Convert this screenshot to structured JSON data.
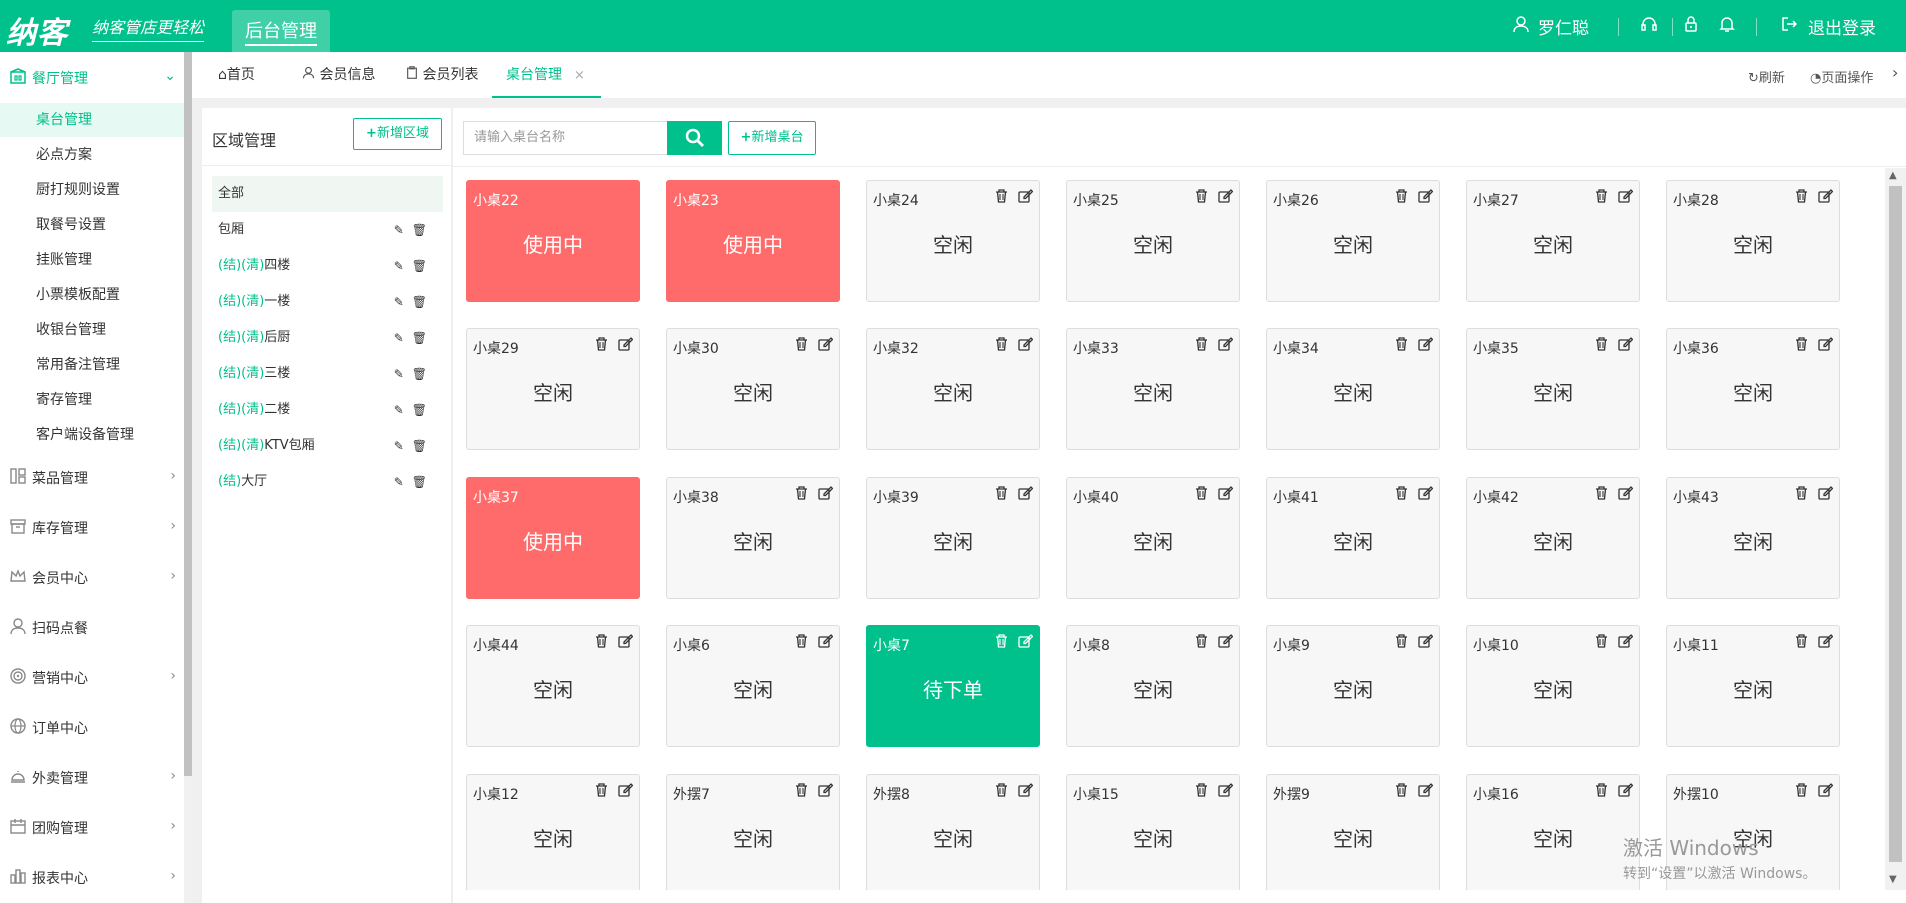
{
  "header": {
    "logo": "纳客",
    "slogan": "纳客管店更轻松",
    "app_tab": "后台管理",
    "user_name": "罗仁聪",
    "logout_label": "退出登录"
  },
  "sidebar": {
    "groups": [
      {
        "label": "餐厅管理",
        "icon": "restaurant-icon",
        "expanded": true,
        "items": [
          "桌台管理",
          "必点方案",
          "厨打规则设置",
          "取餐号设置",
          "挂账管理",
          "小票模板配置",
          "收银台管理",
          "常用备注管理",
          "寄存管理",
          "客户端设备管理"
        ],
        "active_item": "桌台管理"
      },
      {
        "label": "菜品管理",
        "icon": "dishes-icon"
      },
      {
        "label": "库存管理",
        "icon": "inventory-icon"
      },
      {
        "label": "会员中心",
        "icon": "crown-icon"
      },
      {
        "label": "扫码点餐",
        "icon": "user-icon"
      },
      {
        "label": "营销中心",
        "icon": "target-icon"
      },
      {
        "label": "订单中心",
        "icon": "globe-icon"
      },
      {
        "label": "外卖管理",
        "icon": "cloche-icon"
      },
      {
        "label": "团购管理",
        "icon": "calendar-icon"
      },
      {
        "label": "报表中心",
        "icon": "bar-chart-icon"
      }
    ]
  },
  "tabs": [
    {
      "label": "首页",
      "icon": "home-icon"
    },
    {
      "label": "会员信息",
      "icon": "user-icon"
    },
    {
      "label": "会员列表",
      "icon": "clipboard-icon"
    },
    {
      "label": "桌台管理",
      "active": true,
      "close": "×"
    }
  ],
  "tab_actions": {
    "refresh": "刷新",
    "page_ops": "页面操作"
  },
  "area_panel": {
    "title": "区域管理",
    "add_button": "新增区域",
    "all_label": "全部",
    "areas": [
      {
        "prefix": "",
        "name": "包厢"
      },
      {
        "prefix": "(结)(清)",
        "name": "四楼"
      },
      {
        "prefix": "(结)(清)",
        "name": "一楼"
      },
      {
        "prefix": "(结)(清)",
        "name": "后厨"
      },
      {
        "prefix": "(结)(清)",
        "name": "三楼"
      },
      {
        "prefix": "(结)(清)",
        "name": "二楼"
      },
      {
        "prefix": "(结)(清)",
        "name": "KTV包厢"
      },
      {
        "prefix": "(结)",
        "name": "大厅"
      }
    ]
  },
  "table_panel": {
    "search_placeholder": "请输入桌台名称",
    "add_button": "新增桌台",
    "status_labels": {
      "inuse": "使用中",
      "free": "空闲",
      "pending": "待下单"
    },
    "tables": [
      {
        "name": "小桌22",
        "status": "inuse"
      },
      {
        "name": "小桌23",
        "status": "inuse"
      },
      {
        "name": "小桌24",
        "status": "free"
      },
      {
        "name": "小桌25",
        "status": "free"
      },
      {
        "name": "小桌26",
        "status": "free"
      },
      {
        "name": "小桌27",
        "status": "free"
      },
      {
        "name": "小桌28",
        "status": "free"
      },
      {
        "name": "小桌29",
        "status": "free"
      },
      {
        "name": "小桌30",
        "status": "free"
      },
      {
        "name": "小桌32",
        "status": "free"
      },
      {
        "name": "小桌33",
        "status": "free"
      },
      {
        "name": "小桌34",
        "status": "free"
      },
      {
        "name": "小桌35",
        "status": "free"
      },
      {
        "name": "小桌36",
        "status": "free"
      },
      {
        "name": "小桌37",
        "status": "inuse"
      },
      {
        "name": "小桌38",
        "status": "free"
      },
      {
        "name": "小桌39",
        "status": "free"
      },
      {
        "name": "小桌40",
        "status": "free"
      },
      {
        "name": "小桌41",
        "status": "free"
      },
      {
        "name": "小桌42",
        "status": "free"
      },
      {
        "name": "小桌43",
        "status": "free"
      },
      {
        "name": "小桌44",
        "status": "free"
      },
      {
        "name": "小桌6",
        "status": "free"
      },
      {
        "name": "小桌7",
        "status": "pending"
      },
      {
        "name": "小桌8",
        "status": "free"
      },
      {
        "name": "小桌9",
        "status": "free"
      },
      {
        "name": "小桌10",
        "status": "free"
      },
      {
        "name": "小桌11",
        "status": "free"
      },
      {
        "name": "小桌12",
        "status": "free"
      },
      {
        "name": "外摆7",
        "status": "free"
      },
      {
        "name": "外摆8",
        "status": "free"
      },
      {
        "name": "小桌15",
        "status": "free"
      },
      {
        "name": "外摆9",
        "status": "free"
      },
      {
        "name": "小桌16",
        "status": "free"
      },
      {
        "name": "外摆10",
        "status": "free"
      }
    ]
  },
  "watermark": {
    "line1": "激活 Windows",
    "line2": "转到“设置”以激活 Windows。"
  },
  "colors": {
    "primary": "#00c08b",
    "inuse": "#ff6b6b",
    "free_bg": "#f7f7f7"
  }
}
